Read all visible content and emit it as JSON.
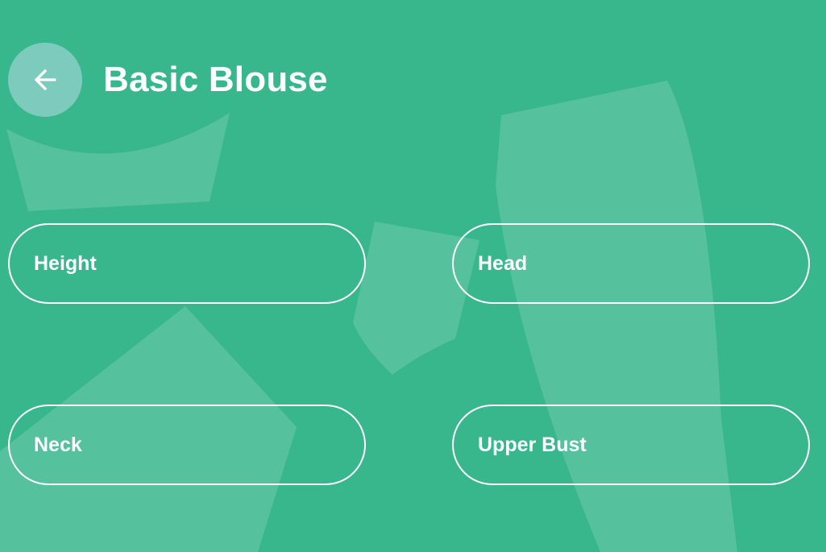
{
  "header": {
    "title": "Basic Blouse",
    "back_icon": "arrow-left-icon"
  },
  "fields": {
    "height": {
      "label": "Height"
    },
    "head": {
      "label": "Head"
    },
    "neck": {
      "label": "Neck"
    },
    "upper_bust": {
      "label": "Upper Bust"
    }
  },
  "colors": {
    "background": "#38b78c",
    "shape_overlay": "rgba(255,255,255,0.15)",
    "text": "#ffffff",
    "back_button": "rgba(180,220,230,0.55)"
  }
}
